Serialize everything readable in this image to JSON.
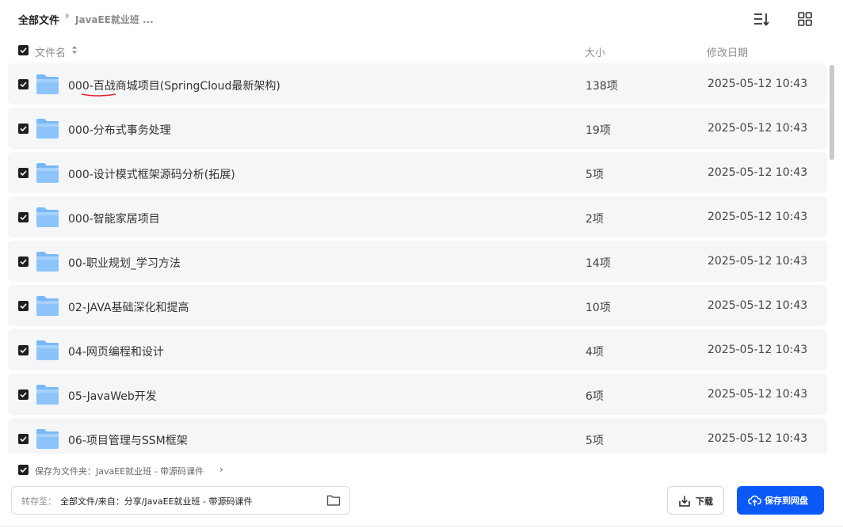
{
  "breadcrumb": {
    "root": "全部文件",
    "current": "JavaEE就业班 ..."
  },
  "icons": {
    "sort": "sort-list-icon",
    "grid": "grid-view-icon",
    "folder": "folder-icon",
    "download": "download-icon",
    "cloud_upload": "cloud-upload-icon"
  },
  "columns": {
    "name": "文件名",
    "size": "大小",
    "modified": "修改日期"
  },
  "files": [
    {
      "name": "000-百战商城项目(SpringCloud最新架构)",
      "size": "138项",
      "modified": "2025-05-12 10:43",
      "checked": true
    },
    {
      "name": "000-分布式事务处理",
      "size": "19项",
      "modified": "2025-05-12 10:43",
      "checked": true
    },
    {
      "name": "000-设计模式框架源码分析(拓展)",
      "size": "5项",
      "modified": "2025-05-12 10:43",
      "checked": true
    },
    {
      "name": "000-智能家居项目",
      "size": "2项",
      "modified": "2025-05-12 10:43",
      "checked": true
    },
    {
      "name": "00-职业规划_学习方法",
      "size": "14项",
      "modified": "2025-05-12 10:43",
      "checked": true
    },
    {
      "name": "02-JAVA基础深化和提高",
      "size": "10项",
      "modified": "2025-05-12 10:43",
      "checked": true
    },
    {
      "name": "04-网页编程和设计",
      "size": "4项",
      "modified": "2025-05-12 10:43",
      "checked": true
    },
    {
      "name": "05-JavaWeb开发",
      "size": "6项",
      "modified": "2025-05-12 10:43",
      "checked": true
    },
    {
      "name": "06-项目管理与SSM框架",
      "size": "5项",
      "modified": "2025-05-12 10:43",
      "checked": true
    }
  ],
  "footer": {
    "save_as_folder": "保存为文件夹：JavaEE就业班 - 带源码课件",
    "save_as_chevron": "›",
    "save_to_label": "转存至：",
    "save_to_value": "全部文件/来自：分享/JavaEE就业班 - 带源码课件",
    "download_label": "下载",
    "save_button_label": "保存到网盘"
  },
  "colors": {
    "primary": "#0a59f7",
    "row_bg": "#f5f6f8",
    "checkbox": "#1f1f1f",
    "folder": "#5aa9f5",
    "annotation": "#e0242b"
  }
}
